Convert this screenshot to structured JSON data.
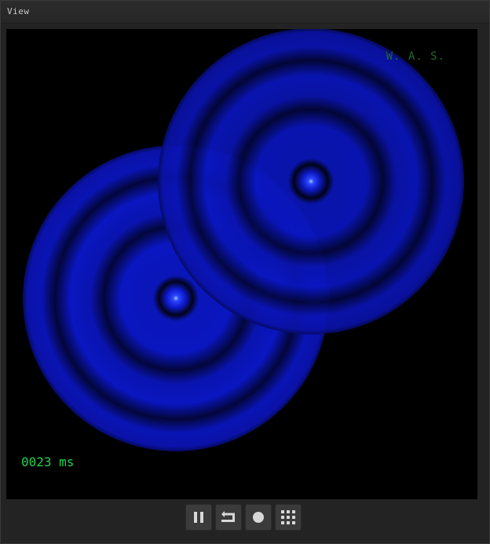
{
  "window": {
    "title": "View"
  },
  "viewport": {
    "watermark": "W. A. S.",
    "elapsed": "0023 ms",
    "colors": {
      "background": "#000000",
      "wave": "#0a14c8",
      "wave_dark": "#03063a",
      "source": "#3a5cff",
      "watermark": "#1c6a2a",
      "timer": "#1fd24a"
    }
  },
  "toolbar": {
    "buttons": [
      {
        "name": "pause-button",
        "icon": "pause-icon"
      },
      {
        "name": "reset-button",
        "icon": "return-arrow-icon"
      },
      {
        "name": "record-button",
        "icon": "circle-icon"
      },
      {
        "name": "grid-button",
        "icon": "grid-icon"
      }
    ],
    "colors": {
      "button": "#3b3b3b",
      "icon": "#d8d8d8"
    }
  }
}
